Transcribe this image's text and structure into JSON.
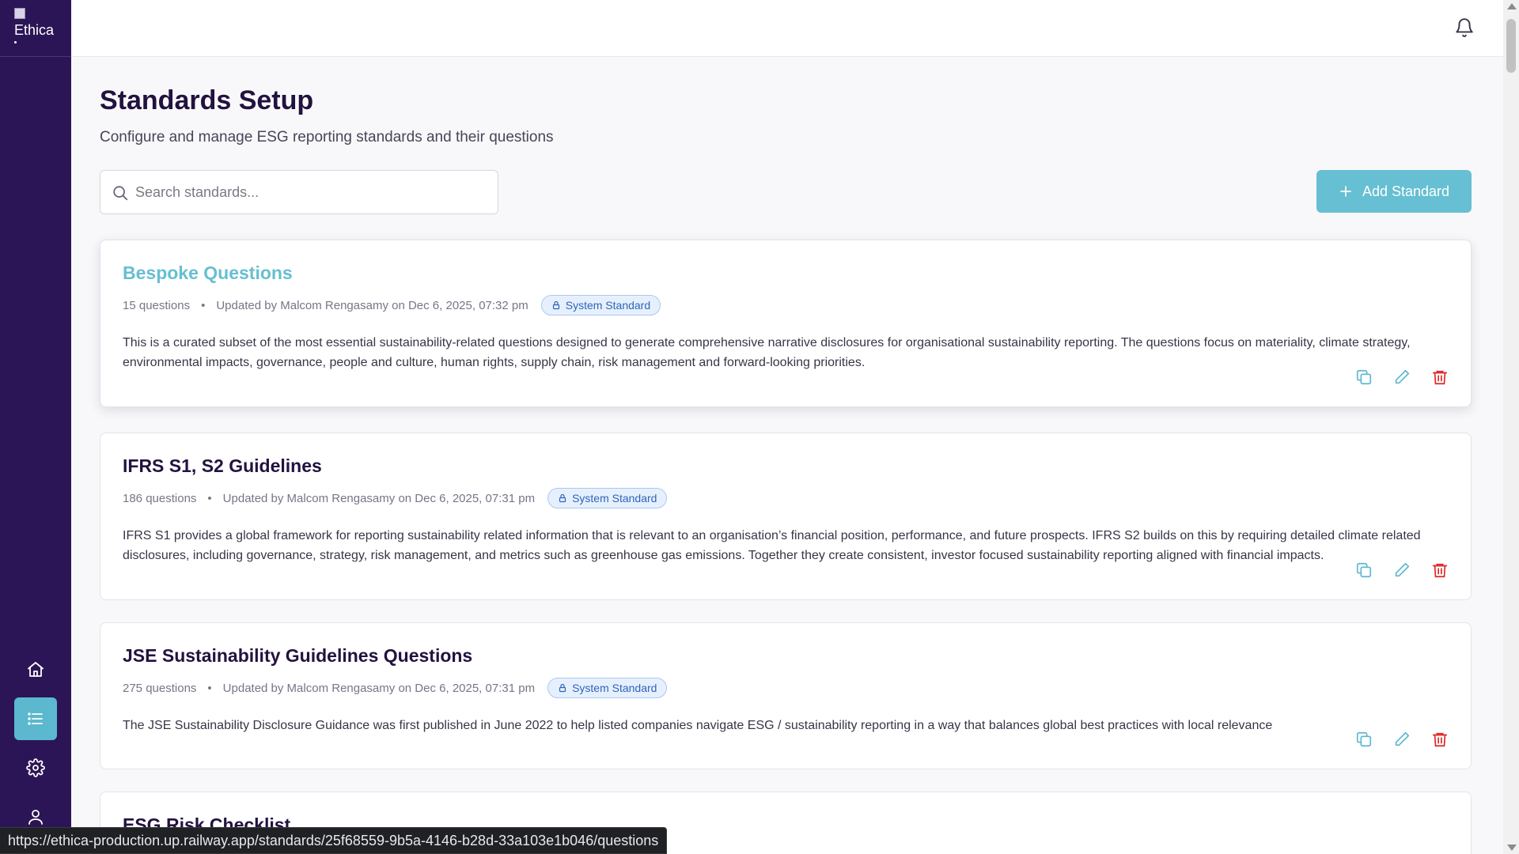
{
  "app": {
    "logo_alt": "Ethica"
  },
  "page": {
    "title": "Standards Setup",
    "subtitle": "Configure and manage ESG reporting standards and their questions"
  },
  "search": {
    "placeholder": "Search standards..."
  },
  "toolbar": {
    "add_label": "Add Standard"
  },
  "standards": [
    {
      "title": "Bespoke Questions",
      "questions": "15 questions",
      "updated": "Updated by Malcom Rengasamy on Dec 6, 2025, 07:32 pm",
      "badge": "System Standard",
      "description": "This is a curated subset of the most essential sustainability-related questions designed to generate comprehensive narrative disclosures for organisational sustainability reporting. The questions focus on materiality, climate strategy, environmental impacts, governance, people and culture, human rights, supply chain, risk management and forward-looking priorities."
    },
    {
      "title": "IFRS S1, S2 Guidelines",
      "questions": "186 questions",
      "updated": "Updated by Malcom Rengasamy on Dec 6, 2025, 07:31 pm",
      "badge": "System Standard",
      "description": "IFRS S1 provides a global framework for reporting sustainability related information that is relevant to an organisation’s financial position, performance, and future prospects. IFRS S2 builds on this by requiring detailed climate related disclosures, including governance, strategy, risk management, and metrics such as greenhouse gas emissions. Together they create consistent, investor focused sustainability reporting aligned with financial impacts."
    },
    {
      "title": "JSE Sustainability Guidelines Questions",
      "questions": "275 questions",
      "updated": "Updated by Malcom Rengasamy on Dec 6, 2025, 07:31 pm",
      "badge": "System Standard",
      "description": "The JSE Sustainability Disclosure Guidance was first published in June 2022 to help listed companies navigate ESG / sustainability reporting in a way that balances global best practices with local relevance"
    },
    {
      "title": "ESG Risk Checklist"
    }
  ],
  "status_bar": {
    "url": "https://ethica-production.up.railway.app/standards/25f68559-9b5a-4146-b28d-33a103e1b046/questions"
  },
  "colors": {
    "sidebar": "#2b1556",
    "accent": "#66bfd2",
    "danger": "#e02424",
    "badge": "#2f64b8"
  },
  "icons": {
    "nav": [
      "home-icon",
      "list-icon",
      "gear-icon",
      "user-icon"
    ],
    "card_actions": [
      "copy-icon",
      "pencil-icon",
      "trash-icon"
    ]
  }
}
